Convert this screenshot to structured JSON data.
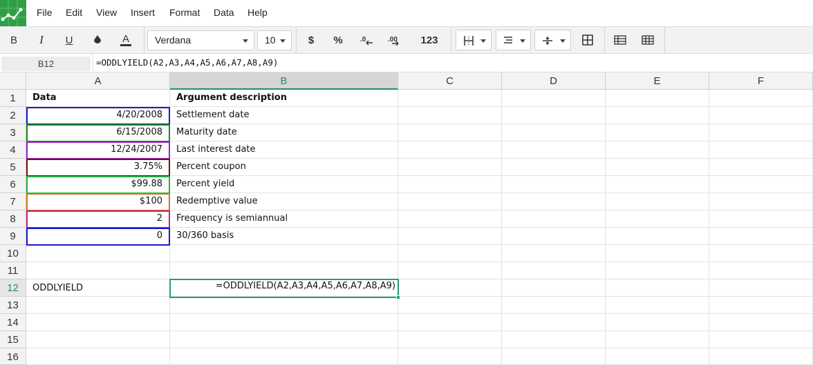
{
  "menu": {
    "file": "File",
    "edit": "Edit",
    "view": "View",
    "insert": "Insert",
    "format": "Format",
    "data": "Data",
    "help": "Help"
  },
  "toolbar": {
    "bold": "B",
    "italic": "I",
    "underline": "U",
    "font": "Verdana",
    "size": "10",
    "currency": "$",
    "percent": "%",
    "dec_decrease": ".0",
    "dec_increase": ".00",
    "number_format": "123",
    "icons": [
      "fill-color-icon",
      "text-color-icon",
      "borders-icon",
      "align-icon",
      "valign-icon",
      "merge-icon",
      "freeze-icon",
      "grid-icon"
    ]
  },
  "formula_bar": {
    "cell_ref": "B12",
    "formula": "=ODDLYIELD(A2,A3,A4,A5,A6,A7,A8,A9)"
  },
  "columns": [
    "A",
    "B",
    "C",
    "D",
    "E",
    "F"
  ],
  "rows": [
    "1",
    "2",
    "3",
    "4",
    "5",
    "6",
    "7",
    "8",
    "9",
    "10",
    "11",
    "12",
    "13",
    "14",
    "15",
    "16"
  ],
  "cells": {
    "A1": "Data",
    "B1": "Argument description",
    "A2": "4/20/2008",
    "B2": "Settlement date",
    "A3": "6/15/2008",
    "B3": "Maturity date",
    "A4": "12/24/2007",
    "B4": "Last interest date",
    "A5": "3.75%",
    "B5": "Percent coupon",
    "A6": "$99.88",
    "B6": "Percent yield",
    "A7": "$100",
    "B7": "Redemptive value",
    "A8": "2",
    "B8": "Frequency is semiannual",
    "A9": "0",
    "B9": "30/360 basis",
    "A12": "ODDLYIELD",
    "B12": "=ODDLYIELD(A2,A3,A4,A5,A6,A7,A8,A9)"
  },
  "colors": {
    "accent": "#1e9e7e",
    "ref_A2": "#1a1acc",
    "ref_A3": "#1a8a1a",
    "ref_A4": "#9a22c4",
    "ref_A5": "#7a1010",
    "ref_A6": "#22b04a",
    "ref_A7": "#d07a10",
    "ref_A8": "#cc2288",
    "ref_A9": "#1a1acc"
  }
}
